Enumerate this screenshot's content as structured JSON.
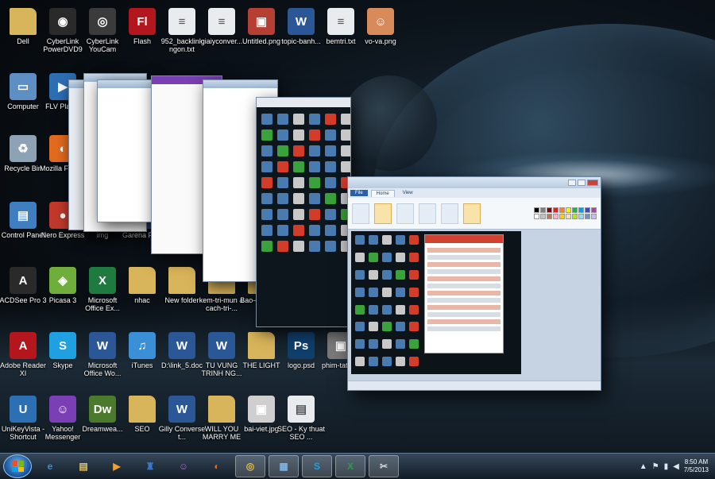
{
  "desktop": {
    "icons": [
      {
        "label": "Dell",
        "icon": "folder-icon",
        "glyph": "",
        "color": "#d8b45a"
      },
      {
        "label": "CyberLink PowerDVD9",
        "icon": "powerdvd-icon",
        "glyph": "◉",
        "color": "#2a2a2a"
      },
      {
        "label": "CyberLink YouCam",
        "icon": "youcam-icon",
        "glyph": "◎",
        "color": "#3b3b3b"
      },
      {
        "label": "Flash",
        "icon": "flash-icon",
        "glyph": "Fl",
        "color": "#b3161c"
      },
      {
        "label": "952_backlink ngon.txt",
        "icon": "text-file-icon",
        "glyph": "≡",
        "color": "#e9ecef"
      },
      {
        "label": "giaiyconver...",
        "icon": "text-file-icon",
        "glyph": "≡",
        "color": "#e9ecef"
      },
      {
        "label": "Untitled.png",
        "icon": "image-file-icon",
        "glyph": "▣",
        "color": "#b63f33"
      },
      {
        "label": "topic-banh...",
        "icon": "word-doc-icon",
        "glyph": "W",
        "color": "#2b5797"
      },
      {
        "label": "bemtri.txt",
        "icon": "text-file-icon",
        "glyph": "≡",
        "color": "#e9ecef"
      },
      {
        "label": "vo-va.png",
        "icon": "image-file-icon",
        "glyph": "☺",
        "color": "#d98a5a"
      },
      {
        "label": "Computer",
        "icon": "computer-icon",
        "glyph": "▭",
        "color": "#5e8fc4"
      },
      {
        "label": "FLV Player",
        "icon": "flv-player-icon",
        "glyph": "▶",
        "color": "#2d6fb3"
      },
      {
        "label": "Recycle Bin",
        "icon": "recycle-bin-icon",
        "glyph": "♻",
        "color": "#8ea2b6"
      },
      {
        "label": "Mozilla Firefox",
        "icon": "firefox-icon",
        "glyph": "◐",
        "color": "#e36b1f"
      },
      {
        "label": "Control Panel",
        "icon": "control-panel-icon",
        "glyph": "▤",
        "color": "#3f7fc1"
      },
      {
        "label": "Nero Express",
        "icon": "nero-icon",
        "glyph": "●",
        "color": "#c0392b"
      },
      {
        "label": "img",
        "icon": "folder-icon",
        "glyph": "",
        "color": "#d8b45a"
      },
      {
        "label": "Garena Plus",
        "icon": "garena-icon",
        "glyph": "G",
        "color": "#3b6fd1"
      },
      {
        "label": "ACDSee Pro 3",
        "icon": "acdsee-icon",
        "glyph": "A",
        "color": "#2a2a2a"
      },
      {
        "label": "Picasa 3",
        "icon": "picasa-icon",
        "glyph": "◈",
        "color": "#6fae3b"
      },
      {
        "label": "Microsoft Office Ex...",
        "icon": "excel-icon",
        "glyph": "X",
        "color": "#1f7a3f"
      },
      {
        "label": "nhac",
        "icon": "folder-icon",
        "glyph": "",
        "color": "#d8b45a"
      },
      {
        "label": "New folder",
        "icon": "folder-icon",
        "glyph": "",
        "color": "#d8b45a"
      },
      {
        "label": "kem-tri-mun & cach-tri-...",
        "icon": "folder-icon",
        "glyph": "",
        "color": "#d8b45a"
      },
      {
        "label": "Bao-cao-tai...",
        "icon": "folder-icon",
        "glyph": "",
        "color": "#d8b45a"
      },
      {
        "label": "Adobe Reader XI",
        "icon": "adobe-reader-icon",
        "glyph": "A",
        "color": "#b3161c"
      },
      {
        "label": "Skype",
        "icon": "skype-icon",
        "glyph": "S",
        "color": "#1fa0e0"
      },
      {
        "label": "Microsoft Office Wo...",
        "icon": "word-icon",
        "glyph": "W",
        "color": "#2b5797"
      },
      {
        "label": "iTunes",
        "icon": "itunes-icon",
        "glyph": "♫",
        "color": "#3a8fd6"
      },
      {
        "label": "D:\\link_5.doc",
        "icon": "word-doc-icon",
        "glyph": "W",
        "color": "#2b5797"
      },
      {
        "label": "TU VUNG TRINH NG...",
        "icon": "word-doc-icon",
        "glyph": "W",
        "color": "#2b5797"
      },
      {
        "label": "THE LIGHT",
        "icon": "folder-icon",
        "glyph": "",
        "color": "#d8b45a"
      },
      {
        "label": "logo.psd",
        "icon": "photoshop-icon",
        "glyph": "Ps",
        "color": "#0f3e6b"
      },
      {
        "label": "phim-tat-2...",
        "icon": "image-file-icon",
        "glyph": "▣",
        "color": "#7a7a7a"
      },
      {
        "label": "UniKeyVista - Shortcut",
        "icon": "unikey-icon",
        "glyph": "U",
        "color": "#2d6fb3"
      },
      {
        "label": "Yahoo! Messenger",
        "icon": "yahoo-messenger-icon",
        "glyph": "☺",
        "color": "#7a3fb4"
      },
      {
        "label": "Dreamwea...",
        "icon": "dreamweaver-icon",
        "glyph": "Dw",
        "color": "#4c7a2c"
      },
      {
        "label": "SEO",
        "icon": "folder-icon",
        "glyph": "",
        "color": "#d8b45a"
      },
      {
        "label": "Gilly Converse t...",
        "icon": "word-doc-icon",
        "glyph": "W",
        "color": "#2b5797"
      },
      {
        "label": "WILL YOU MARRY ME",
        "icon": "folder-icon",
        "glyph": "",
        "color": "#d8b45a"
      },
      {
        "label": "bai-viet.jpg",
        "icon": "image-file-icon",
        "glyph": "▣",
        "color": "#cfcfcf"
      },
      {
        "label": "SEO - Ky thuat SEO ...",
        "icon": "pdf-file-icon",
        "glyph": "▤",
        "color": "#e9ecef"
      }
    ]
  },
  "flip3d": {
    "front_window_tabs": [
      "File",
      "Home",
      "View"
    ],
    "palette": [
      "#000000",
      "#7f7f7f",
      "#880015",
      "#ed1c24",
      "#ff7f27",
      "#fff200",
      "#22b14c",
      "#00a2e8",
      "#3f48cc",
      "#a349a4",
      "#ffffff",
      "#c3c3c3",
      "#b97a57",
      "#ffaec9",
      "#ffc90e",
      "#efe4b0",
      "#b5e61d",
      "#99d9ea",
      "#7092be",
      "#c8bfe7"
    ]
  },
  "taskbar": {
    "pinned": [
      {
        "icon": "internet-explorer-icon",
        "glyph": "e",
        "color": "#3a8fd6",
        "open": false
      },
      {
        "icon": "file-explorer-icon",
        "glyph": "▤",
        "color": "#e0c070",
        "open": false
      },
      {
        "icon": "media-player-icon",
        "glyph": "▶",
        "color": "#f0a030",
        "open": false
      },
      {
        "icon": "cobian-backup-icon",
        "glyph": "♜",
        "color": "#3b7bc8",
        "open": false
      },
      {
        "icon": "yahoo-messenger-icon",
        "glyph": "☺",
        "color": "#a36bd8",
        "open": false
      },
      {
        "icon": "firefox-icon",
        "glyph": "◐",
        "color": "#e36b1f",
        "open": false
      },
      {
        "icon": "chrome-icon",
        "glyph": "◎",
        "color": "#e8c33a",
        "open": true
      },
      {
        "icon": "paint-icon",
        "glyph": "▦",
        "color": "#7fb3e0",
        "open": true
      },
      {
        "icon": "skype-icon",
        "glyph": "S",
        "color": "#1fa0e0",
        "open": true
      },
      {
        "icon": "excel-icon",
        "glyph": "X",
        "color": "#2d9a50",
        "open": true
      },
      {
        "icon": "snipping-tool-icon",
        "glyph": "✂",
        "color": "#d9d9d9",
        "open": true
      }
    ],
    "clock_time": "8:50 AM",
    "clock_date": "7/5/2013"
  }
}
